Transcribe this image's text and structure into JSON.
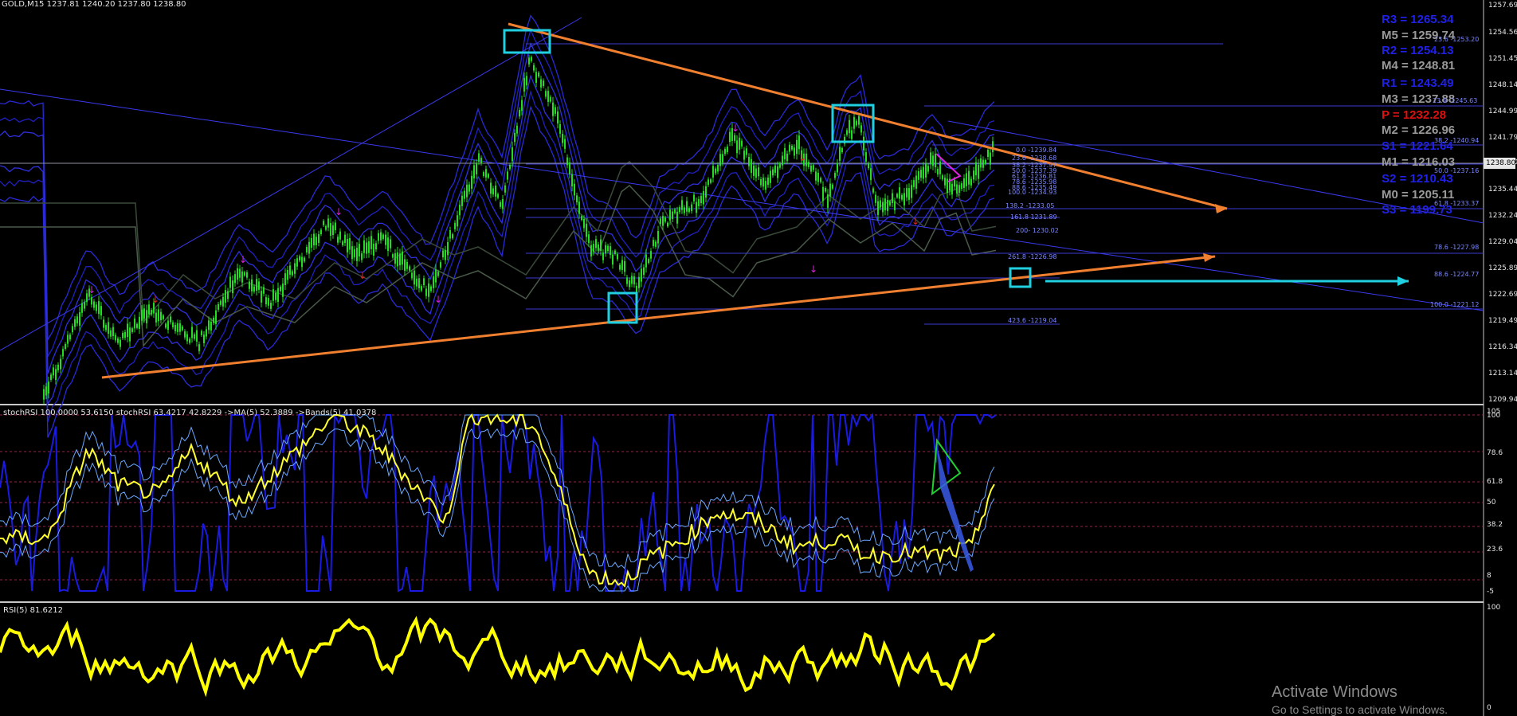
{
  "main_pane": {
    "header": "GOLD,M15  1237.81 1240.20 1237.80 1238.80",
    "current_price": "1238.80",
    "price_axis": [
      "1257.69",
      "1254.56",
      "1251.45",
      "1248.14",
      "1244.99",
      "1241.79",
      "1238.80",
      "1235.44",
      "1232.24",
      "1229.04",
      "1225.89",
      "1222.69",
      "1219.49",
      "1216.34",
      "1213.14",
      "1209.94"
    ],
    "pivots": [
      {
        "label": "R3 = 1265.34",
        "color": "#2020e6"
      },
      {
        "label": "M5 = 1259.74",
        "color": "#9a9a9a"
      },
      {
        "label": "R2 = 1254.13",
        "color": "#2020e6"
      },
      {
        "label": "M4 = 1248.81",
        "color": "#9a9a9a"
      },
      {
        "label": "R1 = 1243.49",
        "color": "#2020e6"
      },
      {
        "label": "M3 = 1237.88",
        "color": "#9a9a9a"
      },
      {
        "label": "P   = 1232.28",
        "color": "#e01010"
      },
      {
        "label": "M2 = 1226.96",
        "color": "#9a9a9a"
      },
      {
        "label": "S1 = 1221.64",
        "color": "#2020e6"
      },
      {
        "label": "M1 = 1216.03",
        "color": "#9a9a9a"
      },
      {
        "label": "S2 = 1210.43",
        "color": "#2020e6"
      },
      {
        "label": "M0 = 1205.11",
        "color": "#9a9a9a"
      },
      {
        "label": "S3 = 1199.73",
        "color": "#2020e6"
      }
    ],
    "fib_left": [
      "0.0 -1239.84",
      "23.6 -1238.68",
      "38.2 -1237.97",
      "50.0 -1237.39",
      "61.8 -1236.81",
      "78.6 -1235.98",
      "88.6 -1235.49",
      "100.0 -1234.93",
      "138.2 -1233.05",
      "161.8 1231.89",
      "200- 1230.02",
      "261.8 -1226.98",
      "423.6 -1219.04"
    ],
    "fib_right": [
      "23.6 -1253.20",
      "23.6 -1245.63",
      "38.2 -1240.94",
      "50.0 -1237.16",
      "61.8 -1233.37",
      "78.6 -1227.98",
      "88.6 -1224.77",
      "100.0 -1221.12"
    ]
  },
  "stoch_pane": {
    "header": "stochRSI 100.0000 53.6150  stochRSI 63.4217 42.8229  ->MA(5) 52.3889  ->Bands(5) 41.0378",
    "axis": [
      "105",
      "100",
      "78.6",
      "61.8",
      "50",
      "38.2",
      "23.6",
      "8",
      "-5"
    ]
  },
  "rsi_pane": {
    "header": "RSI(5) 81.6212",
    "axis": [
      "100",
      "0"
    ]
  },
  "watermark": {
    "title": "Activate Windows",
    "subtitle": "Go to Settings to activate Windows."
  },
  "colors": {
    "candle_up": "#22dd22",
    "trendline": "#f08030",
    "marker_box": "#20d0e0",
    "stoch_blue": "#1a1ae0",
    "rsi_yellow": "#ffff00"
  }
}
